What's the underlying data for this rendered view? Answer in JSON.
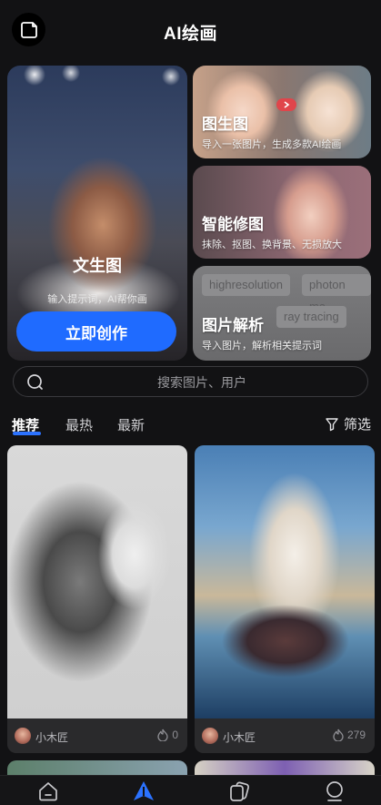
{
  "header": {
    "title": "AI绘画",
    "left_icon": "sticker-icon"
  },
  "hero": {
    "main": {
      "title": "文生图",
      "subtitle": "输入提示词，AI帮你画",
      "button": "立即创作"
    },
    "cards": [
      {
        "title": "图生图",
        "subtitle": "导入一张图片，生成多款AI绘画"
      },
      {
        "title": "智能修图",
        "subtitle": "抹除、抠图、换背景、无损放大"
      },
      {
        "title": "图片解析",
        "subtitle": "导入图片，解析相关提示词",
        "tags": [
          "highresolution",
          "photon ma",
          "ray tracing"
        ]
      }
    ]
  },
  "search": {
    "placeholder": "搜索图片、用户"
  },
  "tabs": [
    {
      "label": "推荐",
      "active": true
    },
    {
      "label": "最热",
      "active": false
    },
    {
      "label": "最新",
      "active": false
    }
  ],
  "filter": {
    "label": "筛选"
  },
  "feed": [
    {
      "author": "小木匠",
      "likes": "0"
    },
    {
      "author": "小木匠",
      "likes": "279"
    }
  ],
  "nav": [
    {
      "icon": "home-icon"
    },
    {
      "icon": "create-icon",
      "active": true
    },
    {
      "icon": "gallery-icon"
    },
    {
      "icon": "profile-icon"
    }
  ],
  "colors": {
    "accent": "#1f6bff",
    "background": "#121214",
    "card": "#2a2a2c"
  }
}
